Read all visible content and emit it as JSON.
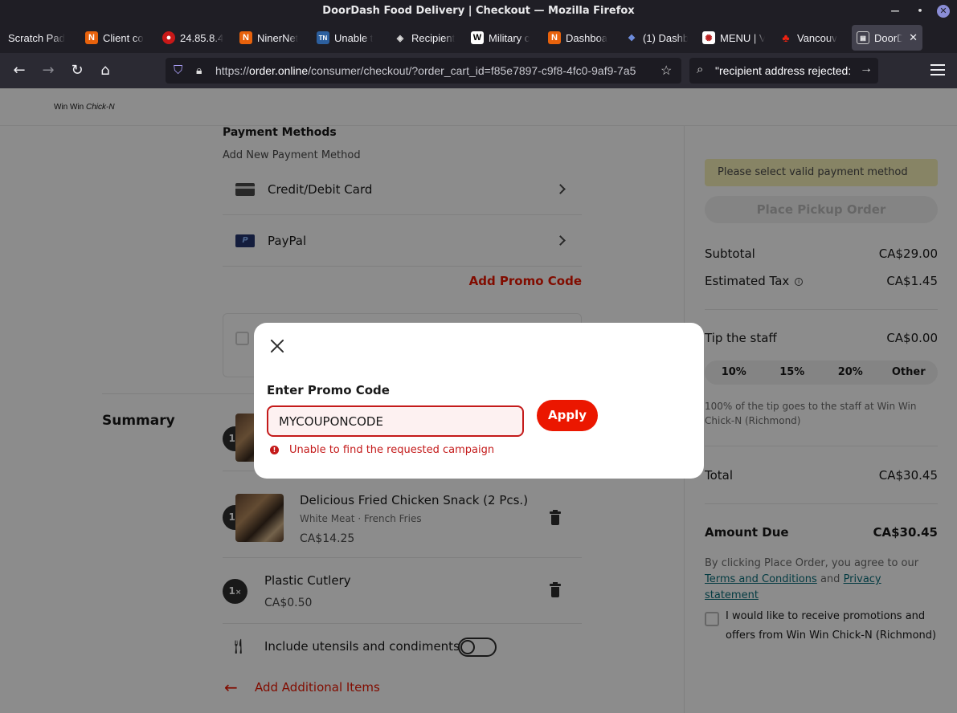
{
  "window": {
    "title": "DoorDash Food Delivery | Checkout — Mozilla Firefox"
  },
  "tabs": [
    {
      "label": "Scratch Pad",
      "icon": "none"
    },
    {
      "label": "Client co",
      "icon": "n-icon"
    },
    {
      "label": "24.85.8.4",
      "icon": "red-hat-icon"
    },
    {
      "label": "NinerNet",
      "icon": "n-icon"
    },
    {
      "label": "Unable t",
      "icon": "tn-icon"
    },
    {
      "label": "Recipient",
      "icon": "diamond-icon"
    },
    {
      "label": "Military c",
      "icon": "wikipedia-icon"
    },
    {
      "label": "Dashboa",
      "icon": "n-icon"
    },
    {
      "label": "(1) Dashb",
      "icon": "nodes-icon"
    },
    {
      "label": "MENU | V",
      "icon": "gear-icon"
    },
    {
      "label": "Vancouv",
      "icon": "maple-leaf-icon"
    },
    {
      "label": "DoorD",
      "icon": "doc-icon",
      "active": true
    }
  ],
  "urlbar": {
    "prefix": "https://",
    "host": "order.online",
    "path": "/consumer/checkout/?order_cart_id=f85e7897-c9f8-4fc0-9af9-7a5"
  },
  "searchbar": {
    "value": "\"recipient address rejected:"
  },
  "header": {
    "brand_a": "Win Win ",
    "brand_b": "Chick-N"
  },
  "payment": {
    "title": "Payment Methods",
    "subtitle": "Add New Payment Method",
    "methods": [
      {
        "label": "Credit/Debit Card"
      },
      {
        "label": "PayPal"
      }
    ],
    "promo_link": "Add Promo Code"
  },
  "summary": {
    "title": "Summary",
    "items": [
      {
        "qty": "1",
        "name": "Delicious Fried Chicken Snack (2 Pcs.)",
        "options": "White Meat · French Fries",
        "price": "CA$14.25"
      },
      {
        "qty": "1",
        "name": "Plastic Cutlery",
        "price": "CA$0.50"
      }
    ],
    "utensils_label": "Include utensils and condiments",
    "add_items": "Add Additional Items"
  },
  "order": {
    "warning": "Please select valid payment method",
    "place_button": "Place Pickup Order",
    "subtotal_label": "Subtotal",
    "subtotal": "CA$29.00",
    "tax_label": "Estimated Tax",
    "tax": "CA$1.45",
    "tip_label": "Tip the staff",
    "tip": "CA$0.00",
    "tip_options": [
      "10%",
      "15%",
      "20%",
      "Other"
    ],
    "tip_note": "100% of the tip goes to the staff at Win Win Chick-N (Richmond)",
    "total_label": "Total",
    "total": "CA$30.45",
    "due_label": "Amount Due",
    "due": "CA$30.45",
    "agree_prefix": "By clicking Place Order, you agree to our ",
    "terms": "Terms and Conditions",
    "and": " and ",
    "privacy": "Privacy statement",
    "optin": "I would like to receive promotions and offers from Win Win Chick-N (Richmond)"
  },
  "modal": {
    "label": "Enter Promo Code",
    "value": "MYCOUPONCODE",
    "apply": "Apply",
    "error": "Unable to find the requested campaign"
  }
}
